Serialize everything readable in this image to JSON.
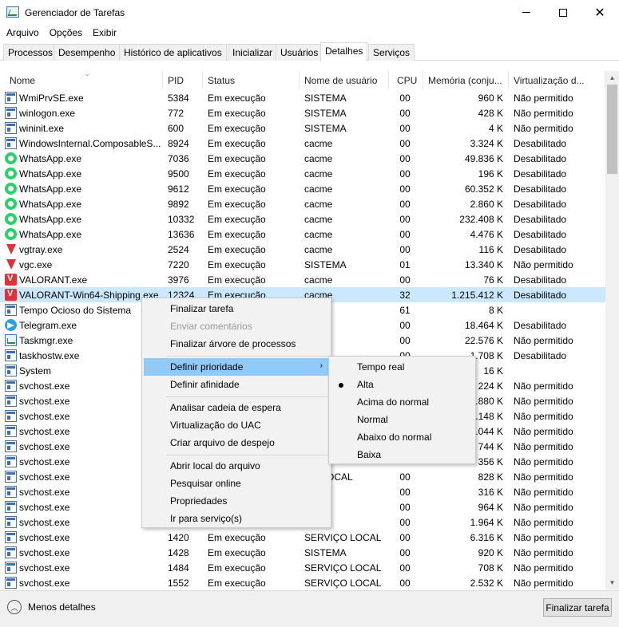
{
  "window": {
    "title": "Gerenciador de Tarefas"
  },
  "menu": [
    "Arquivo",
    "Opções",
    "Exibir"
  ],
  "tabs": [
    {
      "label": "Processos",
      "active": false
    },
    {
      "label": "Desempenho",
      "active": false
    },
    {
      "label": "Histórico de aplicativos",
      "active": false
    },
    {
      "label": "Inicializar",
      "active": false
    },
    {
      "label": "Usuários",
      "active": false
    },
    {
      "label": "Detalhes",
      "active": true
    },
    {
      "label": "Serviços",
      "active": false
    }
  ],
  "columns": [
    "Nome",
    "PID",
    "Status",
    "Nome de usuário",
    "CPU",
    "Memória (conju...",
    "Virtualização d..."
  ],
  "rows": [
    {
      "icon": "service-icon",
      "name": "WmiPrvSE.exe",
      "pid": "5384",
      "status": "Em execução",
      "user": "SISTEMA",
      "cpu": "00",
      "mem": "960 K",
      "virt": "Não permitido"
    },
    {
      "icon": "service-icon",
      "name": "winlogon.exe",
      "pid": "772",
      "status": "Em execução",
      "user": "SISTEMA",
      "cpu": "00",
      "mem": "428 K",
      "virt": "Não permitido"
    },
    {
      "icon": "service-icon",
      "name": "wininit.exe",
      "pid": "600",
      "status": "Em execução",
      "user": "SISTEMA",
      "cpu": "00",
      "mem": "4 K",
      "virt": "Não permitido"
    },
    {
      "icon": "service-icon",
      "name": "WindowsInternal.ComposableS...",
      "pid": "8924",
      "status": "Em execução",
      "user": "cacme",
      "cpu": "00",
      "mem": "3.324 K",
      "virt": "Desabilitado"
    },
    {
      "icon": "whatsapp-icon",
      "name": "WhatsApp.exe",
      "pid": "7036",
      "status": "Em execução",
      "user": "cacme",
      "cpu": "00",
      "mem": "49.836 K",
      "virt": "Desabilitado"
    },
    {
      "icon": "whatsapp-icon",
      "name": "WhatsApp.exe",
      "pid": "9500",
      "status": "Em execução",
      "user": "cacme",
      "cpu": "00",
      "mem": "196 K",
      "virt": "Desabilitado"
    },
    {
      "icon": "whatsapp-icon",
      "name": "WhatsApp.exe",
      "pid": "9612",
      "status": "Em execução",
      "user": "cacme",
      "cpu": "00",
      "mem": "60.352 K",
      "virt": "Desabilitado"
    },
    {
      "icon": "whatsapp-icon",
      "name": "WhatsApp.exe",
      "pid": "9892",
      "status": "Em execução",
      "user": "cacme",
      "cpu": "00",
      "mem": "2.860 K",
      "virt": "Desabilitado"
    },
    {
      "icon": "whatsapp-icon",
      "name": "WhatsApp.exe",
      "pid": "10332",
      "status": "Em execução",
      "user": "cacme",
      "cpu": "00",
      "mem": "232.408 K",
      "virt": "Desabilitado"
    },
    {
      "icon": "whatsapp-icon",
      "name": "WhatsApp.exe",
      "pid": "13636",
      "status": "Em execução",
      "user": "cacme",
      "cpu": "00",
      "mem": "4.476 K",
      "virt": "Desabilitado"
    },
    {
      "icon": "vanguard-icon",
      "name": "vgtray.exe",
      "pid": "2524",
      "status": "Em execução",
      "user": "cacme",
      "cpu": "00",
      "mem": "116 K",
      "virt": "Desabilitado"
    },
    {
      "icon": "vanguard-icon",
      "name": "vgc.exe",
      "pid": "7220",
      "status": "Em execução",
      "user": "SISTEMA",
      "cpu": "01",
      "mem": "13.340 K",
      "virt": "Não permitido"
    },
    {
      "icon": "valorant-icon",
      "name": "VALORANT.exe",
      "pid": "3976",
      "status": "Em execução",
      "user": "cacme",
      "cpu": "00",
      "mem": "76 K",
      "virt": "Desabilitado"
    },
    {
      "icon": "valorant-icon",
      "name": "VALORANT-Win64-Shipping.exe",
      "pid": "12324",
      "status": "Em execução",
      "user": "cacme",
      "cpu": "32",
      "mem": "1.215.412 K",
      "virt": "Desabilitado",
      "selected": true
    },
    {
      "icon": "service-icon",
      "name": "Tempo Ocioso do Sistema",
      "pid": "",
      "status": "",
      "user": "IA",
      "cpu": "61",
      "mem": "8 K",
      "virt": ""
    },
    {
      "icon": "telegram-icon",
      "name": "Telegram.exe",
      "pid": "",
      "status": "",
      "user": "",
      "cpu": "00",
      "mem": "18.464 K",
      "virt": "Desabilitado"
    },
    {
      "icon": "taskmgr-icon",
      "name": "Taskmgr.exe",
      "pid": "",
      "status": "",
      "user": "",
      "cpu": "00",
      "mem": "22.576 K",
      "virt": "Não permitido"
    },
    {
      "icon": "service-icon",
      "name": "taskhostw.exe",
      "pid": "",
      "status": "",
      "user": "",
      "cpu": "00",
      "mem": "1.708 K",
      "virt": "Desabilitado"
    },
    {
      "icon": "service-icon",
      "name": "System",
      "pid": "",
      "status": "",
      "user": "",
      "cpu": "",
      "mem": "16 K",
      "virt": ""
    },
    {
      "icon": "service-icon",
      "name": "svchost.exe",
      "pid": "",
      "status": "",
      "user": "",
      "cpu": "",
      "mem": "224 K",
      "virt": "Não permitido"
    },
    {
      "icon": "service-icon",
      "name": "svchost.exe",
      "pid": "",
      "status": "",
      "user": "",
      "cpu": "",
      "mem": "5.880 K",
      "virt": "Não permitido"
    },
    {
      "icon": "service-icon",
      "name": "svchost.exe",
      "pid": "",
      "status": "",
      "user": "",
      "cpu": "",
      "mem": "5.148 K",
      "virt": "Não permitido"
    },
    {
      "icon": "service-icon",
      "name": "svchost.exe",
      "pid": "",
      "status": "",
      "user": "",
      "cpu": "",
      "mem": ".044 K",
      "virt": "Não permitido"
    },
    {
      "icon": "service-icon",
      "name": "svchost.exe",
      "pid": "",
      "status": "",
      "user": "",
      "cpu": "",
      "mem": "744 K",
      "virt": "Não permitido"
    },
    {
      "icon": "service-icon",
      "name": "svchost.exe",
      "pid": "",
      "status": "",
      "user": "",
      "cpu": "",
      "mem": "356 K",
      "virt": "Não permitido"
    },
    {
      "icon": "service-icon",
      "name": "svchost.exe",
      "pid": "",
      "status": "",
      "user": "ÇO LOCAL",
      "cpu": "00",
      "mem": "828 K",
      "virt": "Não permitido"
    },
    {
      "icon": "service-icon",
      "name": "svchost.exe",
      "pid": "",
      "status": "",
      "user": "MA",
      "cpu": "00",
      "mem": "316 K",
      "virt": "Não permitido"
    },
    {
      "icon": "service-icon",
      "name": "svchost.exe",
      "pid": "",
      "status": "",
      "user": "MA",
      "cpu": "00",
      "mem": "964 K",
      "virt": "Não permitido"
    },
    {
      "icon": "service-icon",
      "name": "svchost.exe",
      "pid": "",
      "status": "",
      "user": "MA",
      "cpu": "00",
      "mem": "1.964 K",
      "virt": "Não permitido"
    },
    {
      "icon": "service-icon",
      "name": "svchost.exe",
      "pid": "1420",
      "status": "Em execução",
      "user": "SERVIÇO LOCAL",
      "cpu": "00",
      "mem": "6.316 K",
      "virt": "Não permitido"
    },
    {
      "icon": "service-icon",
      "name": "svchost.exe",
      "pid": "1428",
      "status": "Em execução",
      "user": "SISTEMA",
      "cpu": "00",
      "mem": "920 K",
      "virt": "Não permitido"
    },
    {
      "icon": "service-icon",
      "name": "svchost.exe",
      "pid": "1484",
      "status": "Em execução",
      "user": "SERVIÇO LOCAL",
      "cpu": "00",
      "mem": "708 K",
      "virt": "Não permitido"
    },
    {
      "icon": "service-icon",
      "name": "svchost.exe",
      "pid": "1552",
      "status": "Em execução",
      "user": "SERVIÇO LOCAL",
      "cpu": "00",
      "mem": "2.532 K",
      "virt": "Não permitido"
    }
  ],
  "context_menu": {
    "items": [
      {
        "label": "Finalizar tarefa",
        "disabled": false
      },
      {
        "label": "Enviar comentários",
        "disabled": true
      },
      {
        "label": "Finalizar árvore de processos",
        "disabled": false
      },
      {
        "sep": true
      },
      {
        "label": "Definir prioridade",
        "submenu": true,
        "highlighted": true
      },
      {
        "label": "Definir afinidade"
      },
      {
        "sep": true
      },
      {
        "label": "Analisar cadeia de espera"
      },
      {
        "label": "Virtualização do UAC"
      },
      {
        "label": "Criar arquivo de despejo"
      },
      {
        "sep": true
      },
      {
        "label": "Abrir local do arquivo"
      },
      {
        "label": "Pesquisar online"
      },
      {
        "label": "Propriedades"
      },
      {
        "label": "Ir para serviço(s)"
      }
    ]
  },
  "priority_submenu": {
    "items": [
      {
        "label": "Tempo real",
        "checked": false
      },
      {
        "label": "Alta",
        "checked": true
      },
      {
        "label": "Acima do normal",
        "checked": false
      },
      {
        "label": "Normal",
        "checked": false
      },
      {
        "label": "Abaixo do normal",
        "checked": false
      },
      {
        "label": "Baixa",
        "checked": false
      }
    ]
  },
  "footer": {
    "less_details": "Menos detalhes",
    "end_task": "Finalizar tarefa"
  },
  "colors": {
    "selected_row": "#cce8ff",
    "menu_highlight": "#91c9f7",
    "menu_bg": "#f2f2f2"
  }
}
